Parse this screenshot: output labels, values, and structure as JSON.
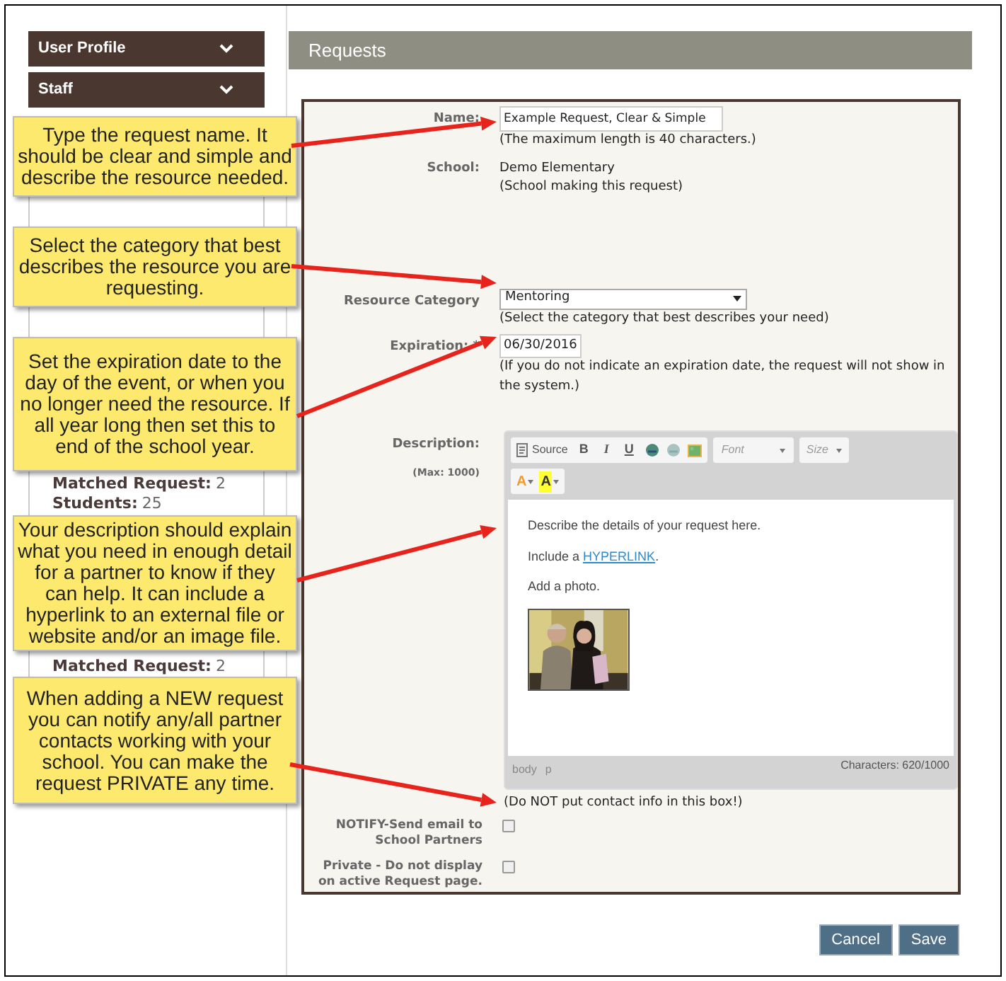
{
  "sidebar": {
    "menus": [
      {
        "label": "User Profile"
      },
      {
        "label": "Staff"
      }
    ],
    "texts": [
      {
        "kind": "field",
        "label": "Matched Request:",
        "value": "2"
      },
      {
        "kind": "field",
        "label": "Students:",
        "value": "25"
      },
      {
        "kind": "field",
        "label": "Matched Request:",
        "value": "2"
      }
    ]
  },
  "header": {
    "title": "Requests"
  },
  "form": {
    "name": {
      "label": "Name:",
      "value": "Example Request, Clear & Simple",
      "hint": "(The maximum length is 40 characters.)"
    },
    "school": {
      "label": "School:",
      "value": "Demo Elementary",
      "hint": "(School making this request)"
    },
    "category": {
      "label": "Resource Category",
      "value": "Mentoring",
      "hint": "(Select the category that best describes your need)"
    },
    "expiration": {
      "label": "Expiration: *",
      "value": "06/30/2016",
      "hint": "(If you do not indicate an expiration date, the request will not show in the system.)"
    },
    "description": {
      "label": "Description:",
      "sublabel": "(Max: 1000)",
      "toolbar": {
        "source": "Source",
        "bold": "B",
        "italic": "I",
        "underline": "U",
        "font": "Font",
        "size": "Size",
        "text_color": "A",
        "bg_color": "A"
      },
      "paragraphs": [
        {
          "text": "Describe the details of your request here."
        },
        {
          "text": "Include a ",
          "link": "HYPERLINK",
          "after": "."
        },
        {
          "text": "Add a photo."
        }
      ],
      "path": [
        "body",
        "p"
      ],
      "counter": "Characters: 620/1000",
      "hint": "(Do NOT put contact info in this box!)"
    },
    "checkboxes": [
      {
        "label": "NOTIFY-Send email to School Partners",
        "checked": false
      },
      {
        "label": "Private - Do not display on active Request page.",
        "checked": false
      }
    ]
  },
  "buttons": [
    {
      "label": "Cancel"
    },
    {
      "label": "Save"
    }
  ],
  "callouts": [
    {
      "text": "Type the request name. It should be clear and simple and describe the resource needed."
    },
    {
      "text": "Select the category that best describes the resource you are requesting."
    },
    {
      "text": "Set the expiration date to the day of the event, or when you no longer need the resource. If all year long then set this to end of the school year."
    },
    {
      "text": "Your description should explain what you need in enough detail for a partner to know if they can help. It can include a hyperlink to an external file or website and/or an image file."
    },
    {
      "text": "When adding a NEW request you can notify any/all partner contacts working with your school. You can make the request PRIVATE any time."
    }
  ]
}
